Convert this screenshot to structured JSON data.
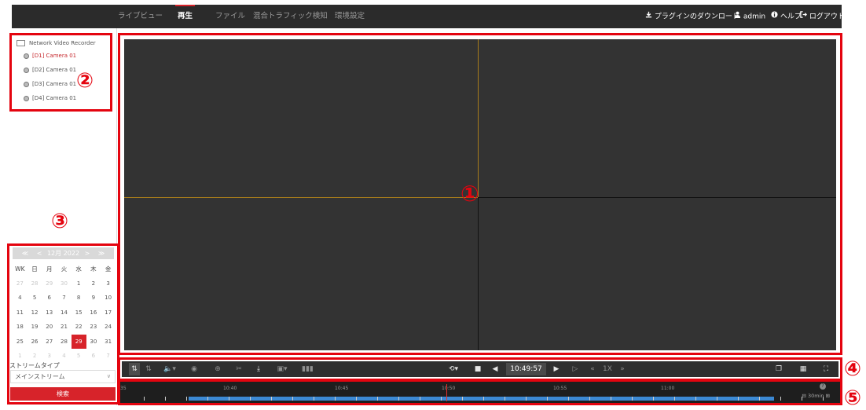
{
  "nav": {
    "tabs": [
      "ライブビュー",
      "再生",
      "ファイル",
      "混合トラフィック検知",
      "環境設定"
    ],
    "active_tab": "再生",
    "plugin_download": "プラグインのダウンロード",
    "user": "admin",
    "help": "ヘルプ",
    "logout": "ログアウト"
  },
  "tree": {
    "root": "Network Video Recorder",
    "cameras": [
      "[D1] Camera 01",
      "[D2] Camera 01",
      "[D3] Camera 01",
      "[D4] Camera 01"
    ]
  },
  "markers": [
    "①",
    "②",
    "③",
    "④",
    "⑤"
  ],
  "calendar": {
    "prev_year": "≪",
    "prev_month": "<",
    "month_year": "12月  2022",
    "next_month": ">",
    "next_year": "≫",
    "weekdays": [
      "WK",
      "日",
      "月",
      "火",
      "水",
      "木",
      "金"
    ],
    "weeks": [
      [
        "27",
        "28",
        "29",
        "30",
        "1",
        "2",
        "3"
      ],
      [
        "4",
        "5",
        "6",
        "7",
        "8",
        "9",
        "10"
      ],
      [
        "11",
        "12",
        "13",
        "14",
        "15",
        "16",
        "17"
      ],
      [
        "18",
        "19",
        "20",
        "21",
        "22",
        "23",
        "24"
      ],
      [
        "25",
        "26",
        "27",
        "28",
        "29",
        "30",
        "31"
      ],
      [
        "1",
        "2",
        "3",
        "4",
        "5",
        "6",
        "7"
      ]
    ],
    "selected_day": "29"
  },
  "stream": {
    "label": "ストリームタイプ",
    "selected": "メインストリーム",
    "search_button": "検索"
  },
  "toolbar": {
    "time": "10:49:57",
    "speed": "1X"
  },
  "timeline": {
    "labels": [
      "35",
      "10:40",
      "10:45",
      "10:50",
      "10:55",
      "11:00"
    ],
    "zoom": "30min",
    "current_fraction": 0.45
  },
  "colors": {
    "accent_red": "#d7232a",
    "annotation_red": "#e4040f",
    "record_blue": "#3c89d4",
    "video_bg": "#333333"
  }
}
